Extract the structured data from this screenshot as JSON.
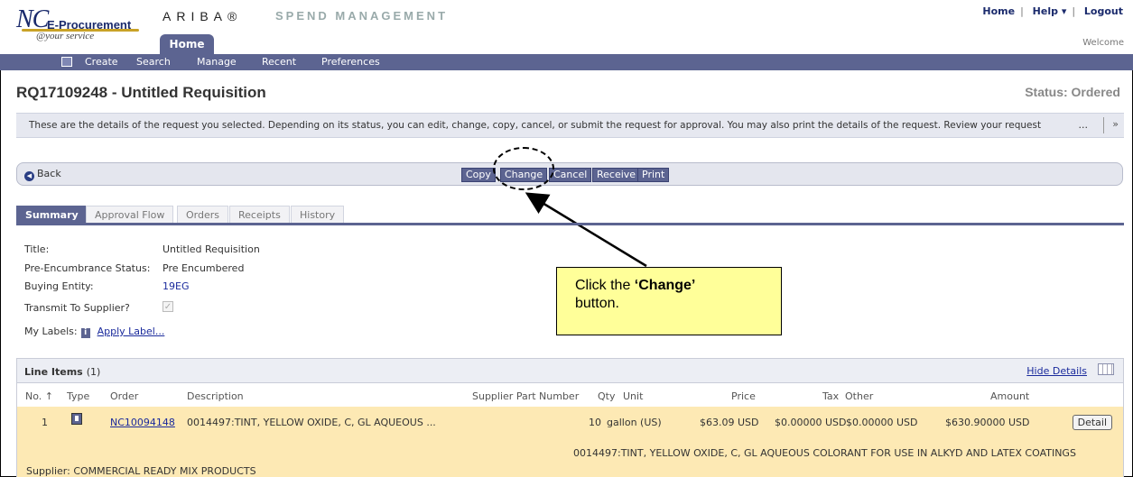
{
  "header": {
    "logo_nc": "NC",
    "logo_ep": "E-Procurement",
    "logo_svc": "@your service",
    "ariba": "ARIBA®",
    "spend_mgmt": "SPEND MANAGEMENT",
    "home_tab": "Home",
    "links": {
      "home": "Home",
      "help": "Help ▾",
      "logout": "Logout"
    },
    "welcome": "Welcome"
  },
  "nav": {
    "items": [
      "Create",
      "Search",
      "Manage",
      "Recent",
      "Preferences"
    ]
  },
  "page": {
    "title": "RQ17109248 - Untitled Requisition",
    "status": "Status: Ordered"
  },
  "infobar": {
    "text": "These are the details of the request you selected. Depending on its status, you can edit, change, copy, cancel, or submit the request for approval. You may also print the details of the request. Review your request",
    "more": "...",
    "expand": "»"
  },
  "actions": {
    "back": "Back",
    "copy": "Copy",
    "change": "Change",
    "cancel": "Cancel",
    "receive": "Receive",
    "print": "Print"
  },
  "callout": {
    "pre": "Click the ",
    "bold": "‘Change’",
    "post": "button."
  },
  "tabs": [
    "Summary",
    "Approval Flow",
    "Orders",
    "Receipts",
    "History"
  ],
  "summary": {
    "title_label": "Title:",
    "title_value": "Untitled Requisition",
    "pre_label": "Pre-Encumbrance Status:",
    "pre_value": "Pre Encumbered",
    "buying_label": "Buying Entity:",
    "buying_value": "19EG",
    "transmit_label": "Transmit To Supplier?",
    "transmit_checked": true,
    "labels_label": "My Labels:",
    "apply_label": "Apply Label..."
  },
  "line_items": {
    "title": "Line Items",
    "count": "(1)",
    "hide_details": "Hide Details",
    "columns": {
      "no": "No. ↑",
      "type": "Type",
      "order": "Order",
      "description": "Description",
      "part": "Supplier Part Number",
      "qty": "Qty",
      "unit": "Unit",
      "price": "Price",
      "tax": "Tax",
      "other": "Other",
      "amount": "Amount"
    },
    "rows": [
      {
        "no": "1",
        "order": "NC10094148",
        "description": "0014497:TINT, YELLOW OXIDE, C, GL AQUEOUS ...",
        "qty": "10",
        "unit": "gallon (US)",
        "price": "$63.09 USD",
        "tax": "$0.00000 USD",
        "other": "$0.00000 USD",
        "amount": "$630.90000 USD",
        "detail": "Detail",
        "full_description": "0014497:TINT, YELLOW OXIDE, C, GL AQUEOUS COLORANT FOR USE IN ALKYD AND LATEX COATINGS",
        "supplier": "Supplier:  COMMERCIAL READY MIX PRODUCTS"
      }
    ]
  }
}
